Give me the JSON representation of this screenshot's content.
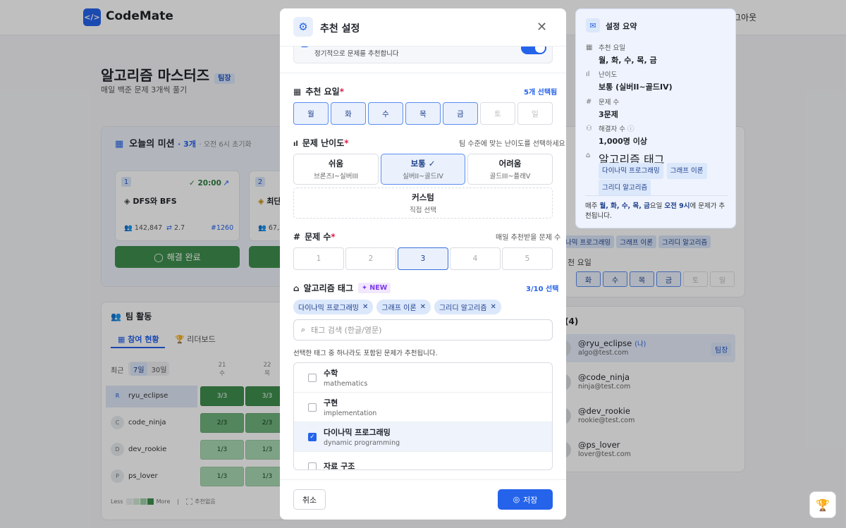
{
  "app": {
    "logo_icon": "</>",
    "name": "CodeMate",
    "logout": "그아웃"
  },
  "page": {
    "title": "알고리즘 마스터즈",
    "badge": "팀장",
    "subtitle": "매일 백준 문제 3개씩 풀기"
  },
  "mission": {
    "title": "오늘의 미션",
    "count": "· 3개",
    "reset": "· 오전 6시 초기화",
    "card1": {
      "num": "1",
      "time": "20:00",
      "name": "DFS와 BFS",
      "solvers": "142,847",
      "level": "2.7",
      "problem": "#1260",
      "button": "해결 완료"
    },
    "card2": {
      "num": "2",
      "name": "최단",
      "solvers": "67,2"
    }
  },
  "team": {
    "title": "팀 활동",
    "tabs": [
      "참여 현황",
      "리더보드"
    ],
    "range_label": "최근",
    "ranges": [
      "7일",
      "30일"
    ],
    "days": [
      {
        "d": "21",
        "w": "수"
      },
      {
        "d": "22",
        "w": "목"
      }
    ],
    "members": [
      {
        "initial": "R",
        "name": "ryu_eclipse",
        "cells": [
          "3/3",
          "3/3"
        ]
      },
      {
        "initial": "C",
        "name": "code_ninja",
        "cells": [
          "2/3",
          "2/3"
        ]
      },
      {
        "initial": "D",
        "name": "dev_rookie",
        "cells": [
          "1/3",
          "1/3"
        ]
      },
      {
        "initial": "P",
        "name": "ps_lover",
        "cells": [
          "1/3",
          "1/3"
        ]
      }
    ],
    "legend_less": "Less",
    "legend_more": "More",
    "legend_none": "추천없음"
  },
  "right_bg": {
    "tags": [
      "나믹 프로그래밍",
      "그래프 이론",
      "그리디 알고리즘"
    ],
    "day_label": "천 요일",
    "days": [
      "화",
      "수",
      "목",
      "금",
      "토",
      "일"
    ],
    "members_title": "(4)",
    "members": [
      {
        "name": "@ryu_eclipse",
        "me": "(나)",
        "email": "algo@test.com",
        "badge": "팀장"
      },
      {
        "name": "@code_ninja",
        "email": "ninja@test.com"
      },
      {
        "name": "@dev_rookie",
        "email": "rookie@test.com"
      },
      {
        "name": "@ps_lover",
        "email": "lover@test.com"
      }
    ]
  },
  "modal": {
    "title": "추천 설정",
    "toggle_desc": "정기적으로 문제를 추천합니다",
    "days_label": "추천 요일",
    "days_count": "5개 선택됨",
    "days": [
      "월",
      "화",
      "수",
      "목",
      "금",
      "토",
      "일"
    ],
    "days_selected": [
      true,
      true,
      true,
      true,
      true,
      false,
      false
    ],
    "diff_label": "문제 난이도",
    "diff_hint": "팀 수준에 맞는 난이도를 선택하세요",
    "difficulties": [
      {
        "title": "쉬움",
        "range": "브론즈I~실버III"
      },
      {
        "title": "보통",
        "range": "실버II~골드IV"
      },
      {
        "title": "어려움",
        "range": "골드III~플래V"
      }
    ],
    "custom": {
      "title": "커스텀",
      "sub": "직접 선택"
    },
    "count_label": "문제 수",
    "count_hint": "매일 추천받을 문제 수",
    "counts": [
      "1",
      "2",
      "3",
      "4",
      "5"
    ],
    "count_selected": "3",
    "tags_label": "알고리즘 태그",
    "tags_new": "NEW",
    "tags_count": "3/10 선택",
    "selected_tags": [
      "다이나믹 프로그래밍",
      "그래프 이론",
      "그리디 알고리즘"
    ],
    "search_placeholder": "태그 검색 (한글/영문)",
    "tags_note": "선택한 태그 중 하나라도 포함된 문제가 추천됩니다.",
    "tag_list": [
      {
        "name": "수학",
        "en": "mathematics",
        "checked": false
      },
      {
        "name": "구현",
        "en": "implementation",
        "checked": false
      },
      {
        "name": "다이나믹 프로그래밍",
        "en": "dynamic programming",
        "checked": true
      },
      {
        "name": "자료 구조",
        "en": "",
        "checked": false
      }
    ],
    "cancel": "취소",
    "save": "저장"
  },
  "summary": {
    "title": "설정 요약",
    "days_label": "추천 요일",
    "days_value": "월, 화, 수, 목, 금",
    "diff_label": "난이도",
    "diff_value": "보통 (실버II~골드IV)",
    "count_label": "문제 수",
    "count_value": "3문제",
    "solvers_label": "해결자 수",
    "solvers_value": "1,000명 이상",
    "tags_label": "알고리즘 태그",
    "tags": [
      "다이나믹 프로그래밍",
      "그래프 이론",
      "그리디 알고리즘"
    ],
    "footer_pre": "매주 ",
    "footer_days": "월, 화, 수, 목, 금",
    "footer_mid": "요일 ",
    "footer_time": "오전 9시",
    "footer_post": "에 문제가 추천됩니다."
  },
  "colors": {
    "accent": "#2563eb",
    "success": "#3f8f4e",
    "required": "#e11d48",
    "new_badge": "#7c3aed"
  }
}
